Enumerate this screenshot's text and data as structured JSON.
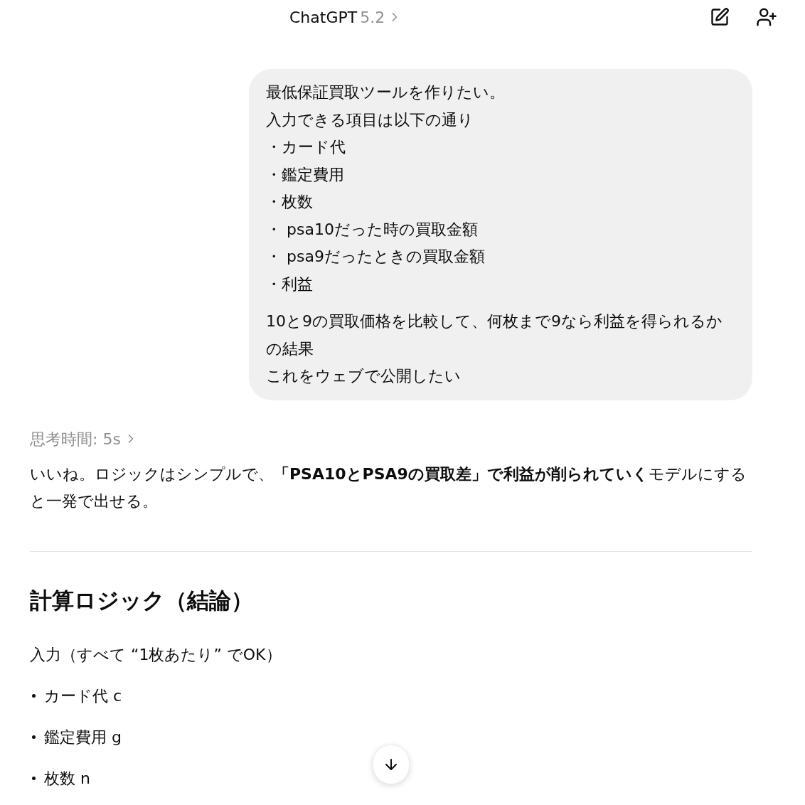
{
  "header": {
    "title": "ChatGPT",
    "version": "5.2"
  },
  "user_message": {
    "paragraphs": [
      [
        "最低保証買取ツールを作りたい。",
        "入力できる項目は以下の通り",
        "・カード代",
        "・鑑定費用",
        "・枚数",
        "・ psa10だった時の買取金額",
        "・ psa9だったときの買取金額",
        "・利益"
      ],
      [
        "10と9の買取価格を比較して、何枚まで9なら利益を得られるかの結果",
        "これをウェブで公開したい"
      ]
    ]
  },
  "thinking": {
    "label": "思考時間: 5s"
  },
  "answer": {
    "intro": "いいね。ロジックはシンプルで、**「PSA10とPSA9の買取差」で利益が削られていく**モデルにすると一発で出せる。",
    "heading": "計算ロジック（結論）",
    "input_label": "入力（すべて “1枚あたり” でOK）",
    "bullets": [
      "カード代 c",
      "鑑定費用 g",
      "枚数 n"
    ]
  }
}
